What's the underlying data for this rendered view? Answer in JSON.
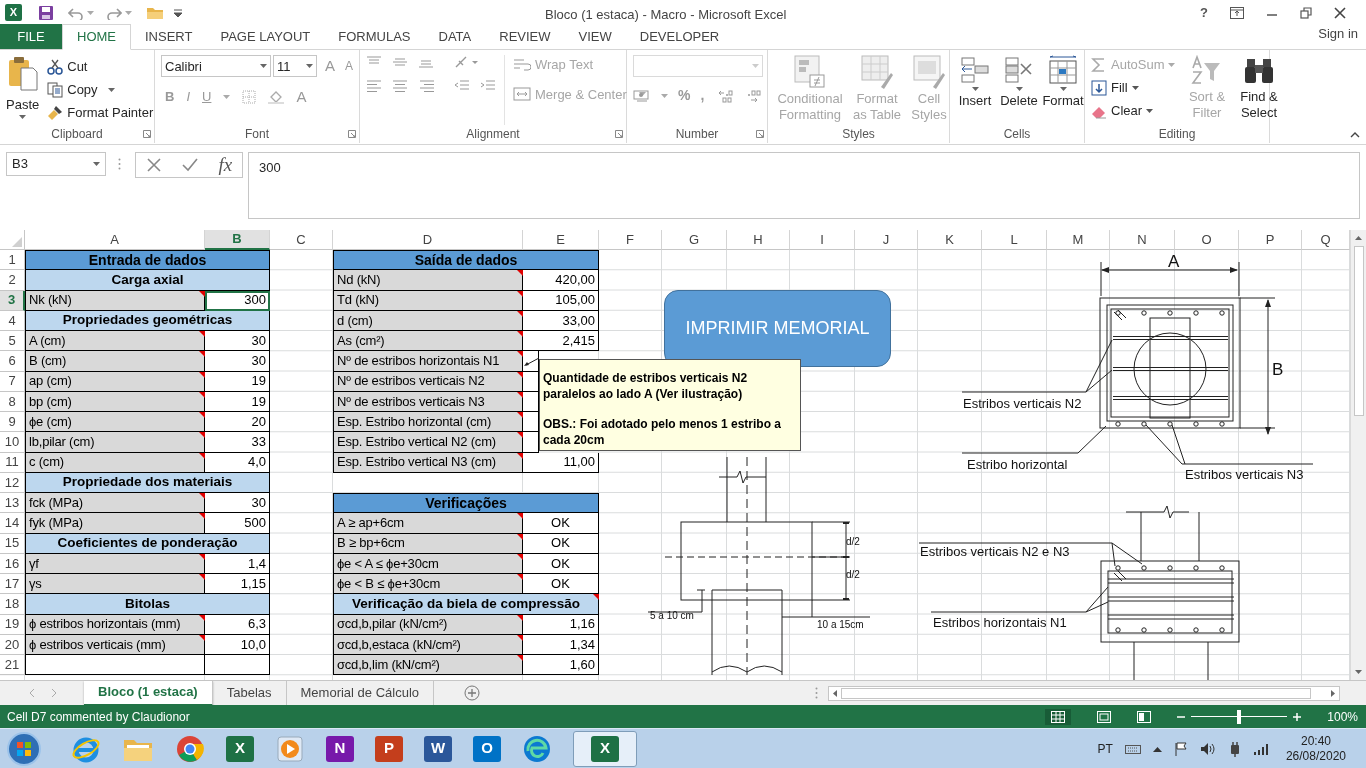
{
  "window": {
    "app_glyph": "X",
    "title": "Bloco (1 estaca) - Macro - Microsoft Excel",
    "help_glyph": "?"
  },
  "ribbon_tabs": [
    {
      "label": "FILE",
      "kind": "file",
      "selected": false
    },
    {
      "label": "HOME",
      "kind": "tab",
      "selected": true
    },
    {
      "label": "INSERT",
      "kind": "tab",
      "selected": false
    },
    {
      "label": "PAGE LAYOUT",
      "kind": "tab",
      "selected": false
    },
    {
      "label": "FORMULAS",
      "kind": "tab",
      "selected": false
    },
    {
      "label": "DATA",
      "kind": "tab",
      "selected": false
    },
    {
      "label": "REVIEW",
      "kind": "tab",
      "selected": false
    },
    {
      "label": "VIEW",
      "kind": "tab",
      "selected": false
    },
    {
      "label": "DEVELOPER",
      "kind": "tab",
      "selected": false
    }
  ],
  "sign_in": "Sign in",
  "clipboard": {
    "label": "Clipboard",
    "paste": "Paste",
    "items": [
      "Cut",
      "Copy",
      "Format Painter"
    ]
  },
  "font": {
    "label": "Font",
    "name": "Calibri",
    "size": "11",
    "glyphs": [
      "B",
      "I",
      "U"
    ],
    "grow": "A",
    "shrink": "A",
    "color_glyph": "A"
  },
  "alignment": {
    "label": "Alignment",
    "buttons": [
      {
        "label": "Wrap Text",
        "disabled": true
      },
      {
        "label": "Merge & Center",
        "disabled": true
      }
    ]
  },
  "number": {
    "label": "Number",
    "symbols": [
      "%",
      ","
    ]
  },
  "styles": {
    "label": "Styles",
    "buttons": [
      {
        "label": "Conditional Formatting",
        "disabled": true
      },
      {
        "label": "Format as Table",
        "disabled": true
      },
      {
        "label": "Cell Styles",
        "disabled": true
      }
    ]
  },
  "cells": {
    "label": "Cells",
    "buttons": [
      {
        "label": "Insert",
        "disabled": false
      },
      {
        "label": "Delete",
        "disabled": false
      },
      {
        "label": "Format",
        "disabled": false
      }
    ]
  },
  "editing": {
    "label": "Editing",
    "small": [
      {
        "label": "AutoSum",
        "disabled": true
      },
      {
        "label": "Fill",
        "disabled": false
      },
      {
        "label": "Clear",
        "disabled": false
      }
    ],
    "large": [
      {
        "label": "Sort & Filter",
        "disabled": true
      },
      {
        "label": "Find & Select",
        "disabled": false
      }
    ]
  },
  "formula_bar": {
    "name_box": "B3",
    "function_glyph": "fx",
    "value": "300"
  },
  "sheet": {
    "columns": [
      {
        "label": "A",
        "selected": false
      },
      {
        "label": "B",
        "selected": true
      },
      {
        "label": "C",
        "selected": false
      },
      {
        "label": "D",
        "selected": false
      },
      {
        "label": "E",
        "selected": false
      },
      {
        "label": "F",
        "selected": false
      },
      {
        "label": "G",
        "selected": false
      },
      {
        "label": "H",
        "selected": false
      },
      {
        "label": "I",
        "selected": false
      },
      {
        "label": "J",
        "selected": false
      },
      {
        "label": "K",
        "selected": false
      },
      {
        "label": "L",
        "selected": false
      },
      {
        "label": "M",
        "selected": false
      },
      {
        "label": "N",
        "selected": false
      },
      {
        "label": "O",
        "selected": false
      },
      {
        "label": "P",
        "selected": false
      },
      {
        "label": "Q",
        "selected": false
      }
    ],
    "rows": [
      {
        "number": "1",
        "selected": false,
        "left": {
          "kind": "title",
          "text": "Entrada de dados"
        },
        "right": {
          "kind": "title",
          "text": "Saída de dados"
        }
      },
      {
        "number": "2",
        "selected": false,
        "left": {
          "kind": "section",
          "text": "Carga axial",
          "comment": false
        },
        "right": {
          "kind": "field",
          "label": "Nd (kN)",
          "value": "420,00",
          "comment": true,
          "selected": false
        }
      },
      {
        "number": "3",
        "selected": true,
        "left": {
          "kind": "field",
          "label": "Nk (kN)",
          "value": "300",
          "comment": true,
          "selected": true
        },
        "right": {
          "kind": "field",
          "label": "Td (kN)",
          "value": "105,00",
          "comment": true,
          "selected": false
        }
      },
      {
        "number": "4",
        "selected": false,
        "left": {
          "kind": "section",
          "text": "Propriedades geométricas",
          "comment": false
        },
        "right": {
          "kind": "field",
          "label": "d (cm)",
          "value": "33,00",
          "comment": true,
          "selected": false
        }
      },
      {
        "number": "5",
        "selected": false,
        "left": {
          "kind": "field",
          "label": "A (cm)",
          "value": "30",
          "comment": true,
          "selected": false
        },
        "right": {
          "kind": "field",
          "label": "As (cm²)",
          "value": "2,415",
          "comment": true,
          "selected": false
        }
      },
      {
        "number": "6",
        "selected": false,
        "left": {
          "kind": "field",
          "label": "B (cm)",
          "value": "30",
          "comment": true,
          "selected": false
        },
        "right": {
          "kind": "field",
          "label": "Nº de estribos horizontais N1",
          "comment": true,
          "selected": false
        }
      },
      {
        "number": "7",
        "selected": false,
        "left": {
          "kind": "field",
          "label": "ap (cm)",
          "value": "19",
          "comment": true,
          "selected": false
        },
        "right": {
          "kind": "field",
          "label": "Nº de estribos verticais N2",
          "comment": true,
          "selected": false
        }
      },
      {
        "number": "8",
        "selected": false,
        "left": {
          "kind": "field",
          "label": "bp (cm)",
          "value": "19",
          "comment": true,
          "selected": false
        },
        "right": {
          "kind": "field",
          "label": "Nº de estribos verticais N3",
          "comment": true,
          "selected": false
        }
      },
      {
        "number": "9",
        "selected": false,
        "left": {
          "kind": "field",
          "label": "ϕe (cm)",
          "value": "20",
          "comment": true,
          "selected": false
        },
        "right": {
          "kind": "field",
          "label": "Esp. Estribo horizontal (cm)",
          "comment": true,
          "selected": false
        }
      },
      {
        "number": "10",
        "selected": false,
        "left": {
          "kind": "field",
          "label": "lb,pilar (cm)",
          "value": "33",
          "comment": true,
          "selected": false
        },
        "right": {
          "kind": "field",
          "label": "Esp. Estribo vertical N2 (cm)",
          "comment": true,
          "selected": false
        }
      },
      {
        "number": "11",
        "selected": false,
        "left": {
          "kind": "field",
          "label": "c (cm)",
          "value": "4,0",
          "comment": true,
          "selected": false
        },
        "right": {
          "kind": "field",
          "label": "Esp. Estribo vertical N3 (cm)",
          "value": "11,00",
          "comment": true,
          "selected": false
        }
      },
      {
        "number": "12",
        "selected": false,
        "left": {
          "kind": "section",
          "text": "Propriedade dos materiais",
          "comment": false
        }
      },
      {
        "number": "13",
        "selected": false,
        "left": {
          "kind": "field",
          "label": "fck (MPa)",
          "value": "30",
          "comment": true,
          "selected": false
        },
        "right": {
          "kind": "title",
          "text": "Verificações"
        }
      },
      {
        "number": "14",
        "selected": false,
        "left": {
          "kind": "field",
          "label": "fyk (MPa)",
          "value": "500",
          "comment": true,
          "selected": false
        },
        "right": {
          "kind": "check",
          "label": "A ≥ ap+6cm",
          "value": "OK",
          "comment": true,
          "selected": false
        }
      },
      {
        "number": "15",
        "selected": false,
        "left": {
          "kind": "section",
          "text": "Coeficientes de ponderação",
          "comment": false
        },
        "right": {
          "kind": "check",
          "label": "B ≥ bp+6cm",
          "value": "OK",
          "comment": true,
          "selected": false
        }
      },
      {
        "number": "16",
        "selected": false,
        "left": {
          "kind": "field",
          "label": "γf",
          "value": "1,4",
          "comment": true,
          "selected": false
        },
        "right": {
          "kind": "check",
          "label": "ϕe < A ≤ ϕe+30cm",
          "value": "OK",
          "comment": true,
          "selected": false
        }
      },
      {
        "number": "17",
        "selected": false,
        "left": {
          "kind": "field",
          "label": "γs",
          "value": "1,15",
          "comment": true,
          "selected": false
        },
        "right": {
          "kind": "check",
          "label": "ϕe < B ≤ ϕe+30cm",
          "value": "OK",
          "comment": true,
          "selected": false
        }
      },
      {
        "number": "18",
        "selected": false,
        "left": {
          "kind": "section",
          "text": "Bitolas",
          "comment": false
        },
        "right": {
          "kind": "section",
          "text": "Verificação da biela de compressão",
          "comment": true
        }
      },
      {
        "number": "19",
        "selected": false,
        "left": {
          "kind": "field",
          "label": "ϕ estribos horizontais (mm)",
          "value": "6,3",
          "comment": true,
          "selected": false
        },
        "right": {
          "kind": "field",
          "label": "σcd,b,pilar (kN/cm²)",
          "value": "1,16",
          "comment": true,
          "selected": false
        }
      },
      {
        "number": "20",
        "selected": false,
        "left": {
          "kind": "field",
          "label": "ϕ estribos verticais (mm)",
          "value": "10,0",
          "comment": true,
          "selected": false
        },
        "right": {
          "kind": "field",
          "label": "σcd,b,estaca (kN/cm²)",
          "value": "1,34",
          "comment": true,
          "selected": false
        }
      },
      {
        "number": "21",
        "selected": false,
        "left": {
          "kind": "blank"
        },
        "right": {
          "kind": "field",
          "label": "σcd,b,lim (kN/cm²)",
          "value": "1,60",
          "comment": true,
          "selected": false
        }
      }
    ],
    "button": "IMPRIMIR MEMORIAL",
    "comment": {
      "paragraphs": [
        "Quantidade de estribos verticais N2 paralelos ao lado A (Ver ilustração)",
        "OBS.: Foi adotado pelo menos 1 estribo a cada 20cm"
      ]
    },
    "drawing_labels": [
      "A",
      "B",
      "Estribos verticais N2",
      "Estribo horizontal",
      "Estribos verticais N3",
      "d/2",
      "d/2",
      "5 a 10 cm",
      "10 a 15cm",
      "Estribos verticais N2 e N3",
      "Estribos horizontais N1"
    ]
  },
  "sheet_tabs": [
    {
      "label": "Bloco (1 estaca)",
      "selected": true
    },
    {
      "label": "Tabelas",
      "selected": false
    },
    {
      "label": "Memorial de Cálculo",
      "selected": false
    }
  ],
  "status_bar": {
    "text": "Cell D7 commented by Claudionor",
    "zoom": {
      "level": 0.5
    },
    "zoom_reading": "100%"
  },
  "taskbar": {
    "apps": [
      {
        "kind": "start",
        "selected": false
      },
      {
        "kind": "ie",
        "selected": false
      },
      {
        "kind": "folder",
        "selected": false
      },
      {
        "kind": "chrome",
        "selected": false
      },
      {
        "kind": "tile",
        "glyph": "X",
        "color": "#1e7145",
        "selected": false
      },
      {
        "kind": "media",
        "selected": false
      },
      {
        "kind": "tile",
        "glyph": "N",
        "color": "#7719aa",
        "selected": false
      },
      {
        "kind": "tile",
        "glyph": "P",
        "color": "#c43e1c",
        "selected": false
      },
      {
        "kind": "tile",
        "glyph": "W",
        "color": "#2b579a",
        "selected": false
      },
      {
        "kind": "tile",
        "glyph": "O",
        "color": "#0072c6",
        "selected": false
      },
      {
        "kind": "edge",
        "selected": false
      },
      {
        "kind": "tile",
        "glyph": "X",
        "color": "#1e7145",
        "selected": true
      }
    ],
    "language": "PT",
    "time": "20:40",
    "date": "26/08/2020"
  }
}
